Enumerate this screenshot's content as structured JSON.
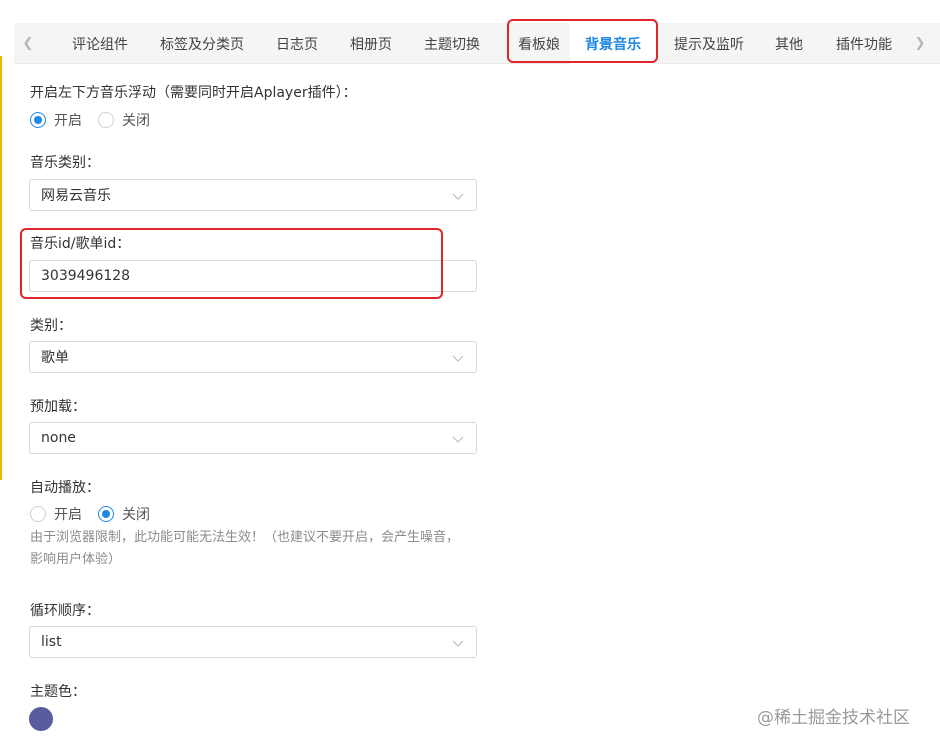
{
  "tabs": {
    "items": [
      {
        "label": "评论组件"
      },
      {
        "label": "标签及分类页"
      },
      {
        "label": "日志页"
      },
      {
        "label": "相册页"
      },
      {
        "label": "主题切换"
      },
      {
        "label": "看板娘"
      },
      {
        "label": "背景音乐",
        "active": true
      },
      {
        "label": "提示及监听"
      },
      {
        "label": "其他"
      },
      {
        "label": "插件功能"
      }
    ]
  },
  "form": {
    "floating_music": {
      "label": "开启左下方音乐浮动（需要同时开启Aplayer插件）：",
      "options": [
        "开启",
        "关闭"
      ],
      "selected": "开启"
    },
    "music_type": {
      "label": "音乐类别：",
      "value": "网易云音乐"
    },
    "music_id": {
      "label": "音乐id/歌单id：",
      "value": "3039496128"
    },
    "category": {
      "label": "类别：",
      "value": "歌单"
    },
    "preload": {
      "label": "预加载：",
      "value": "none"
    },
    "autoplay": {
      "label": "自动播放：",
      "options": [
        "开启",
        "关闭"
      ],
      "selected": "关闭",
      "hint": "由于浏览器限制，此功能可能无法生效！（也建议不要开启，会产生噪音，影响用户体验）"
    },
    "loop": {
      "label": "循环顺序：",
      "value": "list"
    },
    "theme_color": {
      "label": "主题色：",
      "color": "#585c9c"
    }
  },
  "watermark": "@稀土掘金技术社区",
  "colors": {
    "accent": "#1e88e5",
    "highlight_box": "#e0262a",
    "left_bar": "#f5b400"
  }
}
